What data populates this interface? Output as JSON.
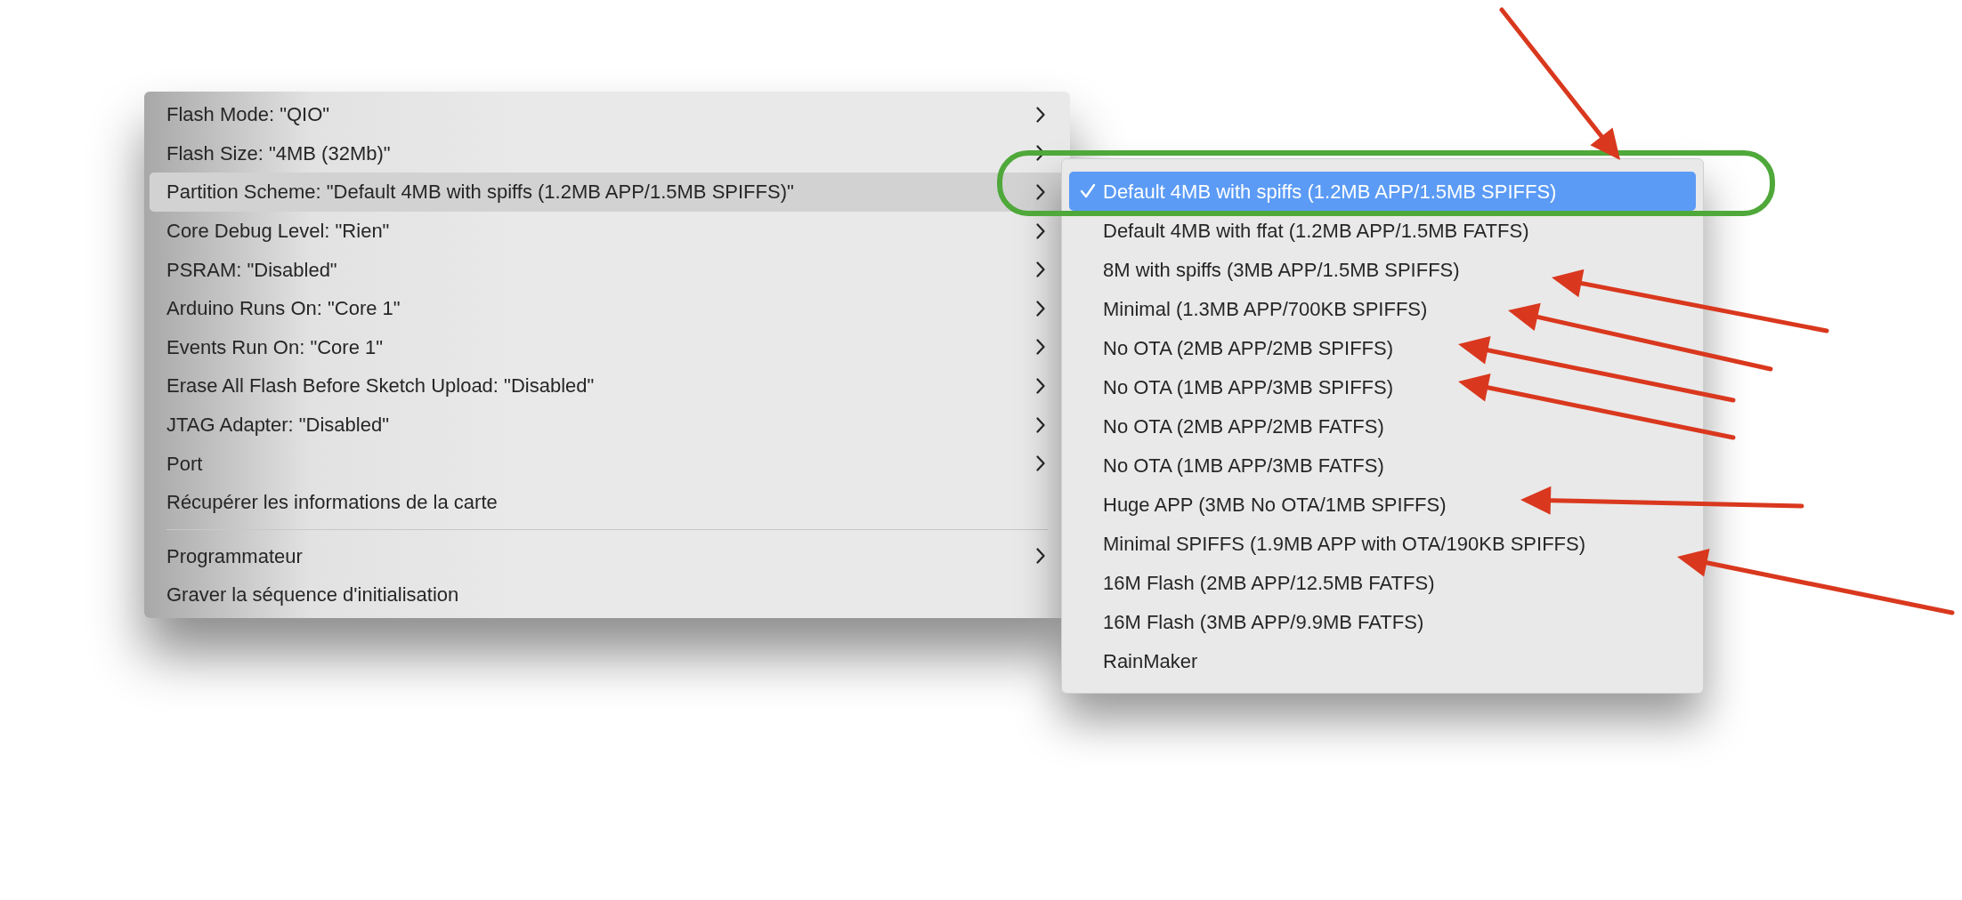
{
  "menu": {
    "sections": [
      {
        "items": [
          {
            "label": "Flash Mode: \"QIO\"",
            "has_submenu": true,
            "selected": false
          },
          {
            "label": "Flash Size: \"4MB (32Mb)\"",
            "has_submenu": true,
            "selected": false
          },
          {
            "label": "Partition Scheme: \"Default 4MB with spiffs (1.2MB APP/1.5MB SPIFFS)\"",
            "has_submenu": true,
            "selected": true
          },
          {
            "label": "Core Debug Level: \"Rien\"",
            "has_submenu": true,
            "selected": false
          },
          {
            "label": "PSRAM: \"Disabled\"",
            "has_submenu": true,
            "selected": false
          },
          {
            "label": "Arduino Runs On: \"Core 1\"",
            "has_submenu": true,
            "selected": false
          },
          {
            "label": "Events Run On: \"Core 1\"",
            "has_submenu": true,
            "selected": false
          },
          {
            "label": "Erase All Flash Before Sketch Upload: \"Disabled\"",
            "has_submenu": true,
            "selected": false
          },
          {
            "label": "JTAG Adapter: \"Disabled\"",
            "has_submenu": true,
            "selected": false
          },
          {
            "label": "Port",
            "has_submenu": true,
            "selected": false
          },
          {
            "label": "Récupérer les informations de la carte",
            "has_submenu": false,
            "selected": false
          }
        ]
      },
      {
        "items": [
          {
            "label": "Programmateur",
            "has_submenu": true,
            "selected": false
          },
          {
            "label": "Graver la séquence d'initialisation",
            "has_submenu": false,
            "selected": false
          }
        ]
      }
    ]
  },
  "submenu": {
    "items": [
      {
        "label": "Default 4MB with spiffs (1.2MB APP/1.5MB SPIFFS)",
        "checked": true,
        "selected": true
      },
      {
        "label": "Default 4MB with ffat (1.2MB APP/1.5MB FATFS)",
        "checked": false,
        "selected": false
      },
      {
        "label": "8M with spiffs (3MB APP/1.5MB SPIFFS)",
        "checked": false,
        "selected": false
      },
      {
        "label": "Minimal (1.3MB APP/700KB SPIFFS)",
        "checked": false,
        "selected": false
      },
      {
        "label": "No OTA (2MB APP/2MB SPIFFS)",
        "checked": false,
        "selected": false
      },
      {
        "label": "No OTA (1MB APP/3MB SPIFFS)",
        "checked": false,
        "selected": false
      },
      {
        "label": "No OTA (2MB APP/2MB FATFS)",
        "checked": false,
        "selected": false
      },
      {
        "label": "No OTA (1MB APP/3MB FATFS)",
        "checked": false,
        "selected": false
      },
      {
        "label": "Huge APP (3MB No OTA/1MB SPIFFS)",
        "checked": false,
        "selected": false
      },
      {
        "label": "Minimal SPIFFS (1.9MB APP with OTA/190KB SPIFFS)",
        "checked": false,
        "selected": false
      },
      {
        "label": "16M Flash (2MB APP/12.5MB FATFS)",
        "checked": false,
        "selected": false
      },
      {
        "label": "16M Flash (3MB APP/9.9MB FATFS)",
        "checked": false,
        "selected": false
      },
      {
        "label": "RainMaker",
        "checked": false,
        "selected": false
      }
    ]
  }
}
